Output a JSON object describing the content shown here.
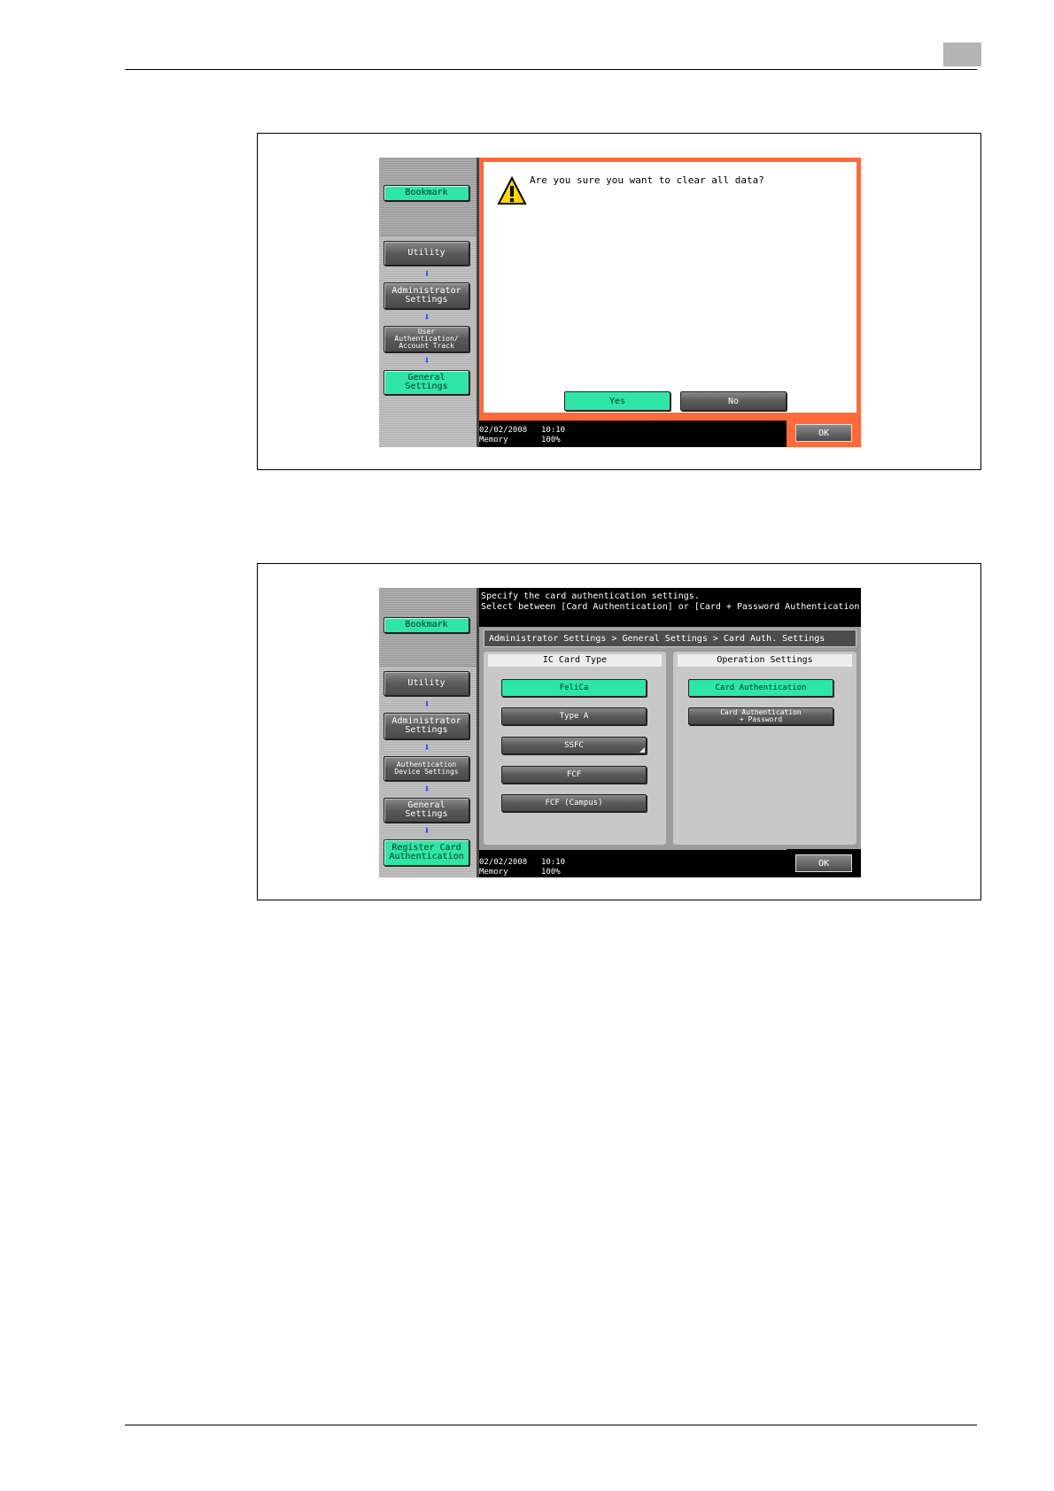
{
  "screen1": {
    "sidebar": {
      "bookmark": "Bookmark",
      "utility": "Utility",
      "admin": "Administrator\nSettings",
      "userauth": "User\nAuthentication/\nAccount Track",
      "general": "General Settings"
    },
    "dialog": {
      "message": "Are you sure you want to clear all data?",
      "yes": "Yes",
      "no": "No"
    },
    "status": {
      "date": "02/02/2008",
      "time": "10:10",
      "memory_label": "Memory",
      "memory_value": "100%"
    },
    "ok": "OK"
  },
  "screen2": {
    "sidebar": {
      "bookmark": "Bookmark",
      "utility": "Utility",
      "admin": "Administrator\nSettings",
      "authdevice": "Authentication\nDevice Settings",
      "general": "General Settings",
      "register": "Register Card\nAuthentication"
    },
    "info_line1": "Specify the card authentication settings.",
    "info_line2": "Select between [Card Authentication] or [Card + Password Authentication].",
    "breadcrumb": "Administrator Settings > General Settings > Card Auth. Settings",
    "ic_card_type": {
      "heading": "IC Card Type",
      "options": [
        "FeliCa",
        "Type A",
        "SSFC",
        "FCF",
        "FCF (Campus)"
      ]
    },
    "operation_settings": {
      "heading": "Operation Settings",
      "options": [
        "Card Authentication",
        "Card Authentication\n+ Password"
      ]
    },
    "status": {
      "date": "02/02/2008",
      "time": "10:10",
      "memory_label": "Memory",
      "memory_value": "100%"
    },
    "ok": "OK"
  },
  "colors": {
    "accent_green": "#2ee6a6",
    "dialog_border": "#ff6a3a"
  }
}
